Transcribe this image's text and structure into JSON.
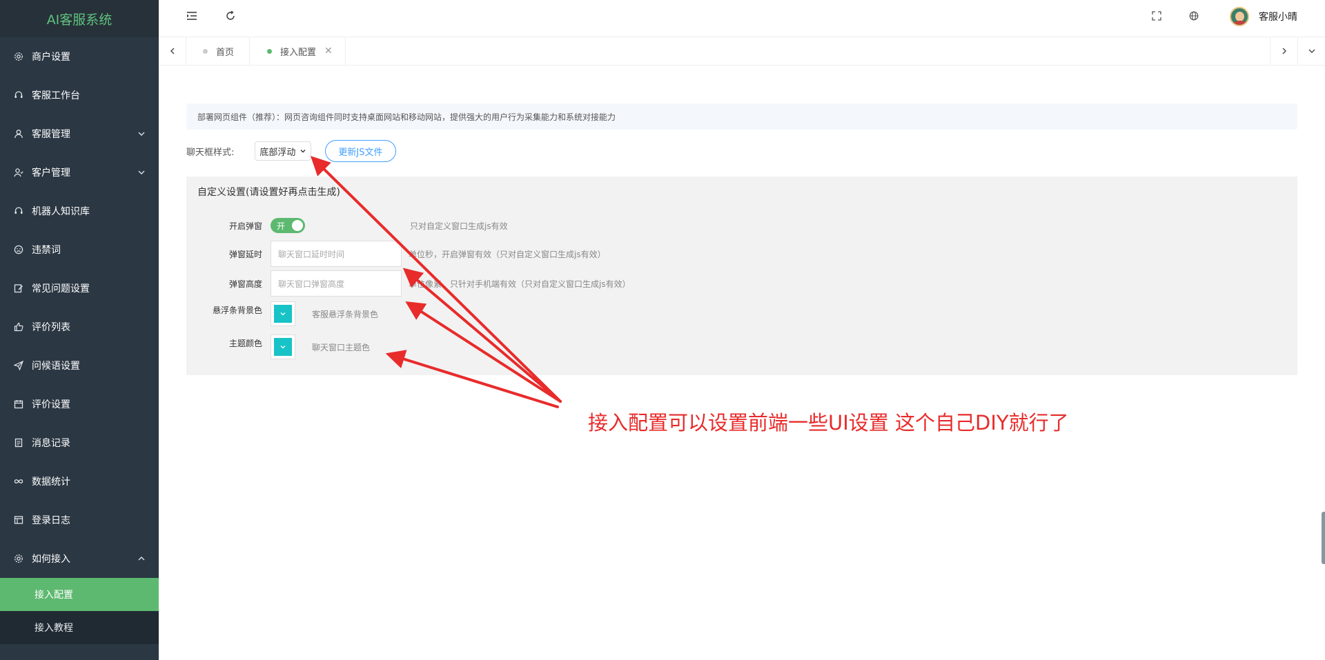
{
  "app": {
    "title": "AI客服系统"
  },
  "sidebar": {
    "items": [
      {
        "label": "商户设置",
        "icon": "gear-icon"
      },
      {
        "label": "客服工作台",
        "icon": "headset-icon"
      },
      {
        "label": "客服管理",
        "icon": "user-icon",
        "expandable": true
      },
      {
        "label": "客户管理",
        "icon": "users-icon",
        "expandable": true
      },
      {
        "label": "机器人知识库",
        "icon": "headset-icon"
      },
      {
        "label": "违禁词",
        "icon": "frown-icon"
      },
      {
        "label": "常见问题设置",
        "icon": "edit-icon"
      },
      {
        "label": "评价列表",
        "icon": "thumbs-up-icon"
      },
      {
        "label": "问候语设置",
        "icon": "send-icon"
      },
      {
        "label": "评价设置",
        "icon": "calendar-icon"
      },
      {
        "label": "消息记录",
        "icon": "document-icon"
      },
      {
        "label": "数据统计",
        "icon": "infinity-icon"
      },
      {
        "label": "登录日志",
        "icon": "table-icon"
      },
      {
        "label": "如何接入",
        "icon": "gear-icon",
        "expanded": true
      }
    ],
    "submenu": [
      {
        "label": "接入配置",
        "active": true
      },
      {
        "label": "接入教程",
        "active": false
      }
    ]
  },
  "header": {
    "user_name": "客服小晴"
  },
  "tabs": [
    {
      "label": "首页",
      "active": false
    },
    {
      "label": "接入配置",
      "active": true,
      "close": "✕"
    }
  ],
  "content": {
    "notice": "部署网页组件（推荐）：网页咨询组件同时支持桌面网站和移动网站，提供强大的用户行为采集能力和系统对接能力",
    "chat_style_label": "聊天框样式:",
    "chat_style_value": "底部浮动",
    "update_button": "更新JS文件",
    "panel_title": "自定义设置(请设置好再点击生成)",
    "fields": {
      "popup": {
        "label": "开启弹窗",
        "toggle_text": "开",
        "hint": "只对自定义窗口生成js有效"
      },
      "delay": {
        "label": "弹窗延时",
        "placeholder": "聊天窗口延时时间",
        "hint": "单位秒，开启弹窗有效（只对自定义窗口生成js有效）"
      },
      "height": {
        "label": "弹窗高度",
        "placeholder": "聊天窗口弹窗高度",
        "hint": "单位像素，只针对手机端有效（只对自定义窗口生成js有效）"
      },
      "float_bg": {
        "label": "悬浮条背景色",
        "hint": "客服悬浮条背景色",
        "color": "#17c3c6"
      },
      "theme": {
        "label": "主题颜色",
        "hint": "聊天窗口主题色",
        "color": "#17c3c6"
      }
    }
  },
  "annotation": {
    "text": "接入配置可以设置前端一些UI设置  这个自己DIY就行了",
    "color": "#e82b2b"
  },
  "colors": {
    "sidebar_bg": "#2b3743",
    "accent_green": "#5db96f",
    "logo_green": "#5fc37f",
    "link_blue": "#409eff"
  }
}
